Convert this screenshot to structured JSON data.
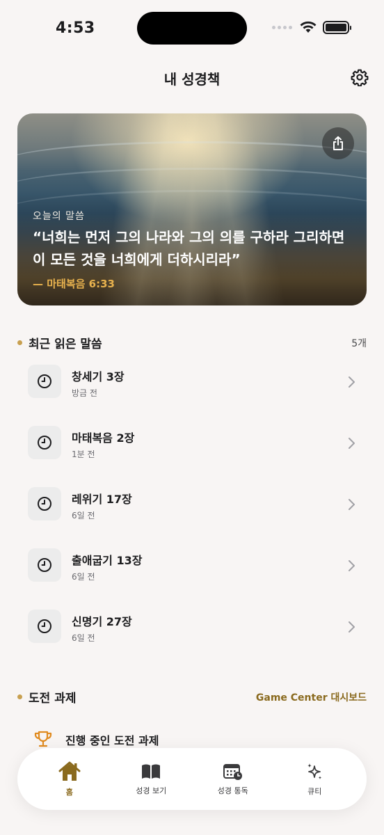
{
  "status_bar": {
    "time": "4:53"
  },
  "header": {
    "title": "내 성경책"
  },
  "hero": {
    "label": "오늘의 말씀",
    "verse": "“너희는 먼저 그의 나라와 그의 의를 구하라 그리하면 이 모든 것을 너희에게 더하시리라”",
    "reference": "— 마태복음 6:33"
  },
  "recent": {
    "title": "최근 읽은 말씀",
    "count": "5개",
    "items": [
      {
        "title": "창세기 3장",
        "time": "방금 전"
      },
      {
        "title": "마태복음 2장",
        "time": "1분 전"
      },
      {
        "title": "레위기 17장",
        "time": "6일 전"
      },
      {
        "title": "출애굽기 13장",
        "time": "6일 전"
      },
      {
        "title": "신명기 27장",
        "time": "6일 전"
      }
    ]
  },
  "challenges": {
    "title": "도전 과제",
    "link": "Game Center 대시보드",
    "in_progress": "진행 중인 도전 과제"
  },
  "tabs": [
    {
      "label": "홈",
      "icon": "home-icon",
      "active": true
    },
    {
      "label": "성경 보기",
      "icon": "book-icon",
      "active": false
    },
    {
      "label": "성경 통독",
      "icon": "calendar-clock-icon",
      "active": false
    },
    {
      "label": "큐티",
      "icon": "sparkles-icon",
      "active": false
    }
  ],
  "colors": {
    "accent": "#8a6a1e",
    "verse_ref": "#e8b24e",
    "bullet": "#c8a050",
    "background": "#f8f5f4"
  }
}
